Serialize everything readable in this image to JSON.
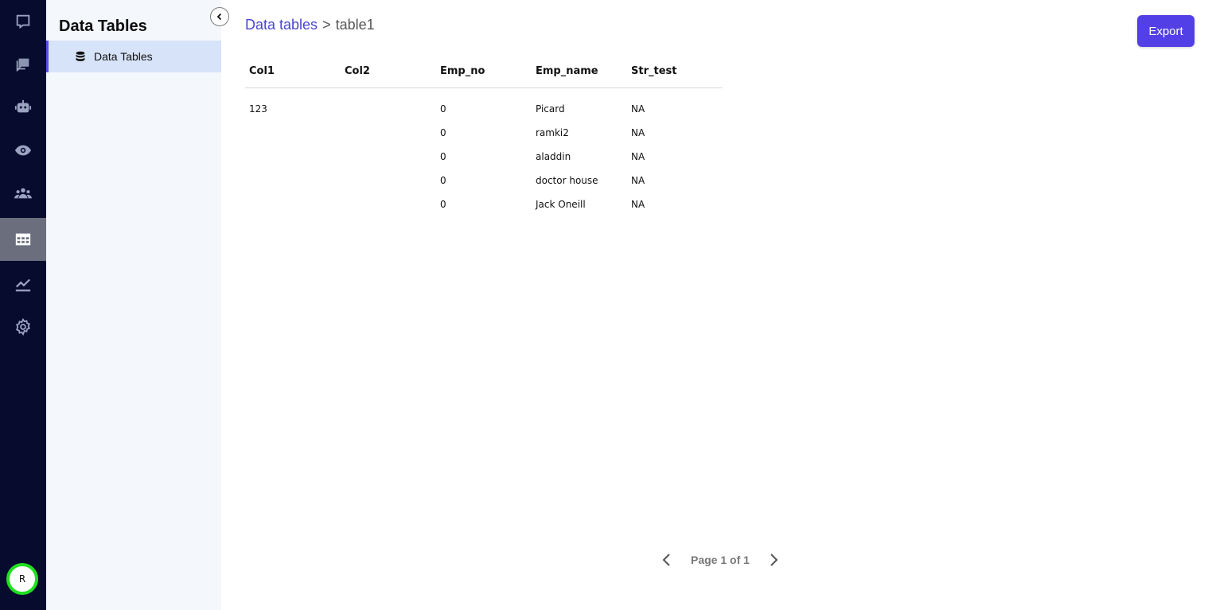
{
  "rail": {
    "items": [
      {
        "name": "logo-icon",
        "icon": "rounded-square"
      },
      {
        "name": "chat-icon",
        "icon": "messages"
      },
      {
        "name": "robot-icon",
        "icon": "robot"
      },
      {
        "name": "eye-icon",
        "icon": "eye"
      },
      {
        "name": "users-icon",
        "icon": "users"
      },
      {
        "name": "table-icon",
        "icon": "grid",
        "active": true
      },
      {
        "name": "chart-icon",
        "icon": "line-chart"
      },
      {
        "name": "gear-icon",
        "icon": "gear"
      }
    ],
    "avatar_initial": "R",
    "colors": {
      "rail_bg": "#070b2e",
      "active_bg": "#6b6e7d",
      "avatar_ring": "#1fe01f"
    }
  },
  "sidebar": {
    "title": "Data Tables",
    "items": [
      {
        "label": "Data Tables",
        "icon": "database-icon",
        "active": true
      }
    ]
  },
  "breadcrumb": {
    "root": "Data tables",
    "separator": ">",
    "current": "table1"
  },
  "toolbar": {
    "export_label": "Export",
    "accent": "#5240e6"
  },
  "table": {
    "columns": [
      "Col1",
      "Col2",
      "Emp_no",
      "Emp_name",
      "Str_test"
    ],
    "rows": [
      [
        "123",
        "",
        "0",
        "Picard",
        "NA"
      ],
      [
        "",
        "",
        "0",
        "ramki2",
        "NA"
      ],
      [
        "",
        "",
        "0",
        "aladdin",
        "NA"
      ],
      [
        "",
        "",
        "0",
        "doctor house",
        "NA"
      ],
      [
        "",
        "",
        "0",
        "Jack Oneill",
        "NA"
      ]
    ]
  },
  "pagination": {
    "text": "Page 1 of 1"
  }
}
